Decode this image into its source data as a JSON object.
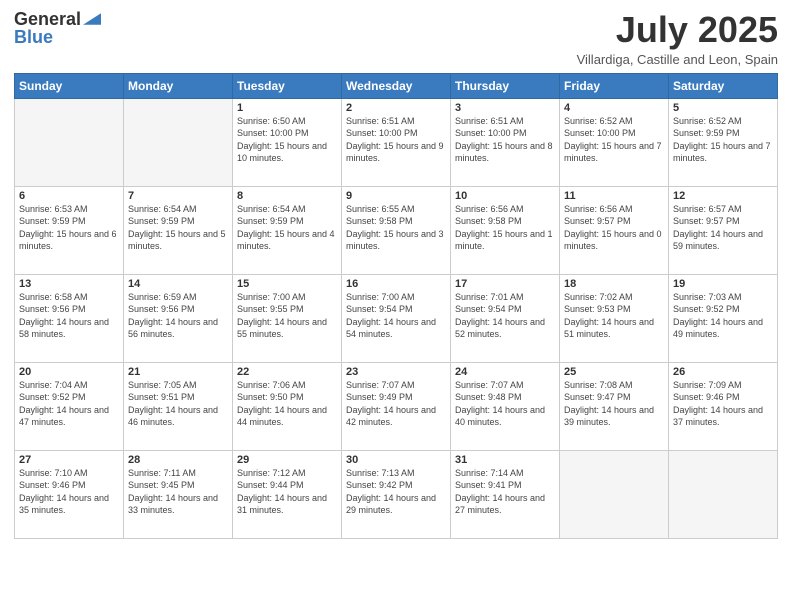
{
  "header": {
    "logo_general": "General",
    "logo_blue": "Blue",
    "month_title": "July 2025",
    "location": "Villardiga, Castille and Leon, Spain"
  },
  "days_of_week": [
    "Sunday",
    "Monday",
    "Tuesday",
    "Wednesday",
    "Thursday",
    "Friday",
    "Saturday"
  ],
  "weeks": [
    [
      {
        "day": null
      },
      {
        "day": null
      },
      {
        "day": "1",
        "sunrise": "Sunrise: 6:50 AM",
        "sunset": "Sunset: 10:00 PM",
        "daylight": "Daylight: 15 hours and 10 minutes."
      },
      {
        "day": "2",
        "sunrise": "Sunrise: 6:51 AM",
        "sunset": "Sunset: 10:00 PM",
        "daylight": "Daylight: 15 hours and 9 minutes."
      },
      {
        "day": "3",
        "sunrise": "Sunrise: 6:51 AM",
        "sunset": "Sunset: 10:00 PM",
        "daylight": "Daylight: 15 hours and 8 minutes."
      },
      {
        "day": "4",
        "sunrise": "Sunrise: 6:52 AM",
        "sunset": "Sunset: 10:00 PM",
        "daylight": "Daylight: 15 hours and 7 minutes."
      },
      {
        "day": "5",
        "sunrise": "Sunrise: 6:52 AM",
        "sunset": "Sunset: 9:59 PM",
        "daylight": "Daylight: 15 hours and 7 minutes."
      }
    ],
    [
      {
        "day": "6",
        "sunrise": "Sunrise: 6:53 AM",
        "sunset": "Sunset: 9:59 PM",
        "daylight": "Daylight: 15 hours and 6 minutes."
      },
      {
        "day": "7",
        "sunrise": "Sunrise: 6:54 AM",
        "sunset": "Sunset: 9:59 PM",
        "daylight": "Daylight: 15 hours and 5 minutes."
      },
      {
        "day": "8",
        "sunrise": "Sunrise: 6:54 AM",
        "sunset": "Sunset: 9:59 PM",
        "daylight": "Daylight: 15 hours and 4 minutes."
      },
      {
        "day": "9",
        "sunrise": "Sunrise: 6:55 AM",
        "sunset": "Sunset: 9:58 PM",
        "daylight": "Daylight: 15 hours and 3 minutes."
      },
      {
        "day": "10",
        "sunrise": "Sunrise: 6:56 AM",
        "sunset": "Sunset: 9:58 PM",
        "daylight": "Daylight: 15 hours and 1 minute."
      },
      {
        "day": "11",
        "sunrise": "Sunrise: 6:56 AM",
        "sunset": "Sunset: 9:57 PM",
        "daylight": "Daylight: 15 hours and 0 minutes."
      },
      {
        "day": "12",
        "sunrise": "Sunrise: 6:57 AM",
        "sunset": "Sunset: 9:57 PM",
        "daylight": "Daylight: 14 hours and 59 minutes."
      }
    ],
    [
      {
        "day": "13",
        "sunrise": "Sunrise: 6:58 AM",
        "sunset": "Sunset: 9:56 PM",
        "daylight": "Daylight: 14 hours and 58 minutes."
      },
      {
        "day": "14",
        "sunrise": "Sunrise: 6:59 AM",
        "sunset": "Sunset: 9:56 PM",
        "daylight": "Daylight: 14 hours and 56 minutes."
      },
      {
        "day": "15",
        "sunrise": "Sunrise: 7:00 AM",
        "sunset": "Sunset: 9:55 PM",
        "daylight": "Daylight: 14 hours and 55 minutes."
      },
      {
        "day": "16",
        "sunrise": "Sunrise: 7:00 AM",
        "sunset": "Sunset: 9:54 PM",
        "daylight": "Daylight: 14 hours and 54 minutes."
      },
      {
        "day": "17",
        "sunrise": "Sunrise: 7:01 AM",
        "sunset": "Sunset: 9:54 PM",
        "daylight": "Daylight: 14 hours and 52 minutes."
      },
      {
        "day": "18",
        "sunrise": "Sunrise: 7:02 AM",
        "sunset": "Sunset: 9:53 PM",
        "daylight": "Daylight: 14 hours and 51 minutes."
      },
      {
        "day": "19",
        "sunrise": "Sunrise: 7:03 AM",
        "sunset": "Sunset: 9:52 PM",
        "daylight": "Daylight: 14 hours and 49 minutes."
      }
    ],
    [
      {
        "day": "20",
        "sunrise": "Sunrise: 7:04 AM",
        "sunset": "Sunset: 9:52 PM",
        "daylight": "Daylight: 14 hours and 47 minutes."
      },
      {
        "day": "21",
        "sunrise": "Sunrise: 7:05 AM",
        "sunset": "Sunset: 9:51 PM",
        "daylight": "Daylight: 14 hours and 46 minutes."
      },
      {
        "day": "22",
        "sunrise": "Sunrise: 7:06 AM",
        "sunset": "Sunset: 9:50 PM",
        "daylight": "Daylight: 14 hours and 44 minutes."
      },
      {
        "day": "23",
        "sunrise": "Sunrise: 7:07 AM",
        "sunset": "Sunset: 9:49 PM",
        "daylight": "Daylight: 14 hours and 42 minutes."
      },
      {
        "day": "24",
        "sunrise": "Sunrise: 7:07 AM",
        "sunset": "Sunset: 9:48 PM",
        "daylight": "Daylight: 14 hours and 40 minutes."
      },
      {
        "day": "25",
        "sunrise": "Sunrise: 7:08 AM",
        "sunset": "Sunset: 9:47 PM",
        "daylight": "Daylight: 14 hours and 39 minutes."
      },
      {
        "day": "26",
        "sunrise": "Sunrise: 7:09 AM",
        "sunset": "Sunset: 9:46 PM",
        "daylight": "Daylight: 14 hours and 37 minutes."
      }
    ],
    [
      {
        "day": "27",
        "sunrise": "Sunrise: 7:10 AM",
        "sunset": "Sunset: 9:46 PM",
        "daylight": "Daylight: 14 hours and 35 minutes."
      },
      {
        "day": "28",
        "sunrise": "Sunrise: 7:11 AM",
        "sunset": "Sunset: 9:45 PM",
        "daylight": "Daylight: 14 hours and 33 minutes."
      },
      {
        "day": "29",
        "sunrise": "Sunrise: 7:12 AM",
        "sunset": "Sunset: 9:44 PM",
        "daylight": "Daylight: 14 hours and 31 minutes."
      },
      {
        "day": "30",
        "sunrise": "Sunrise: 7:13 AM",
        "sunset": "Sunset: 9:42 PM",
        "daylight": "Daylight: 14 hours and 29 minutes."
      },
      {
        "day": "31",
        "sunrise": "Sunrise: 7:14 AM",
        "sunset": "Sunset: 9:41 PM",
        "daylight": "Daylight: 14 hours and 27 minutes."
      },
      {
        "day": null
      },
      {
        "day": null
      }
    ]
  ]
}
